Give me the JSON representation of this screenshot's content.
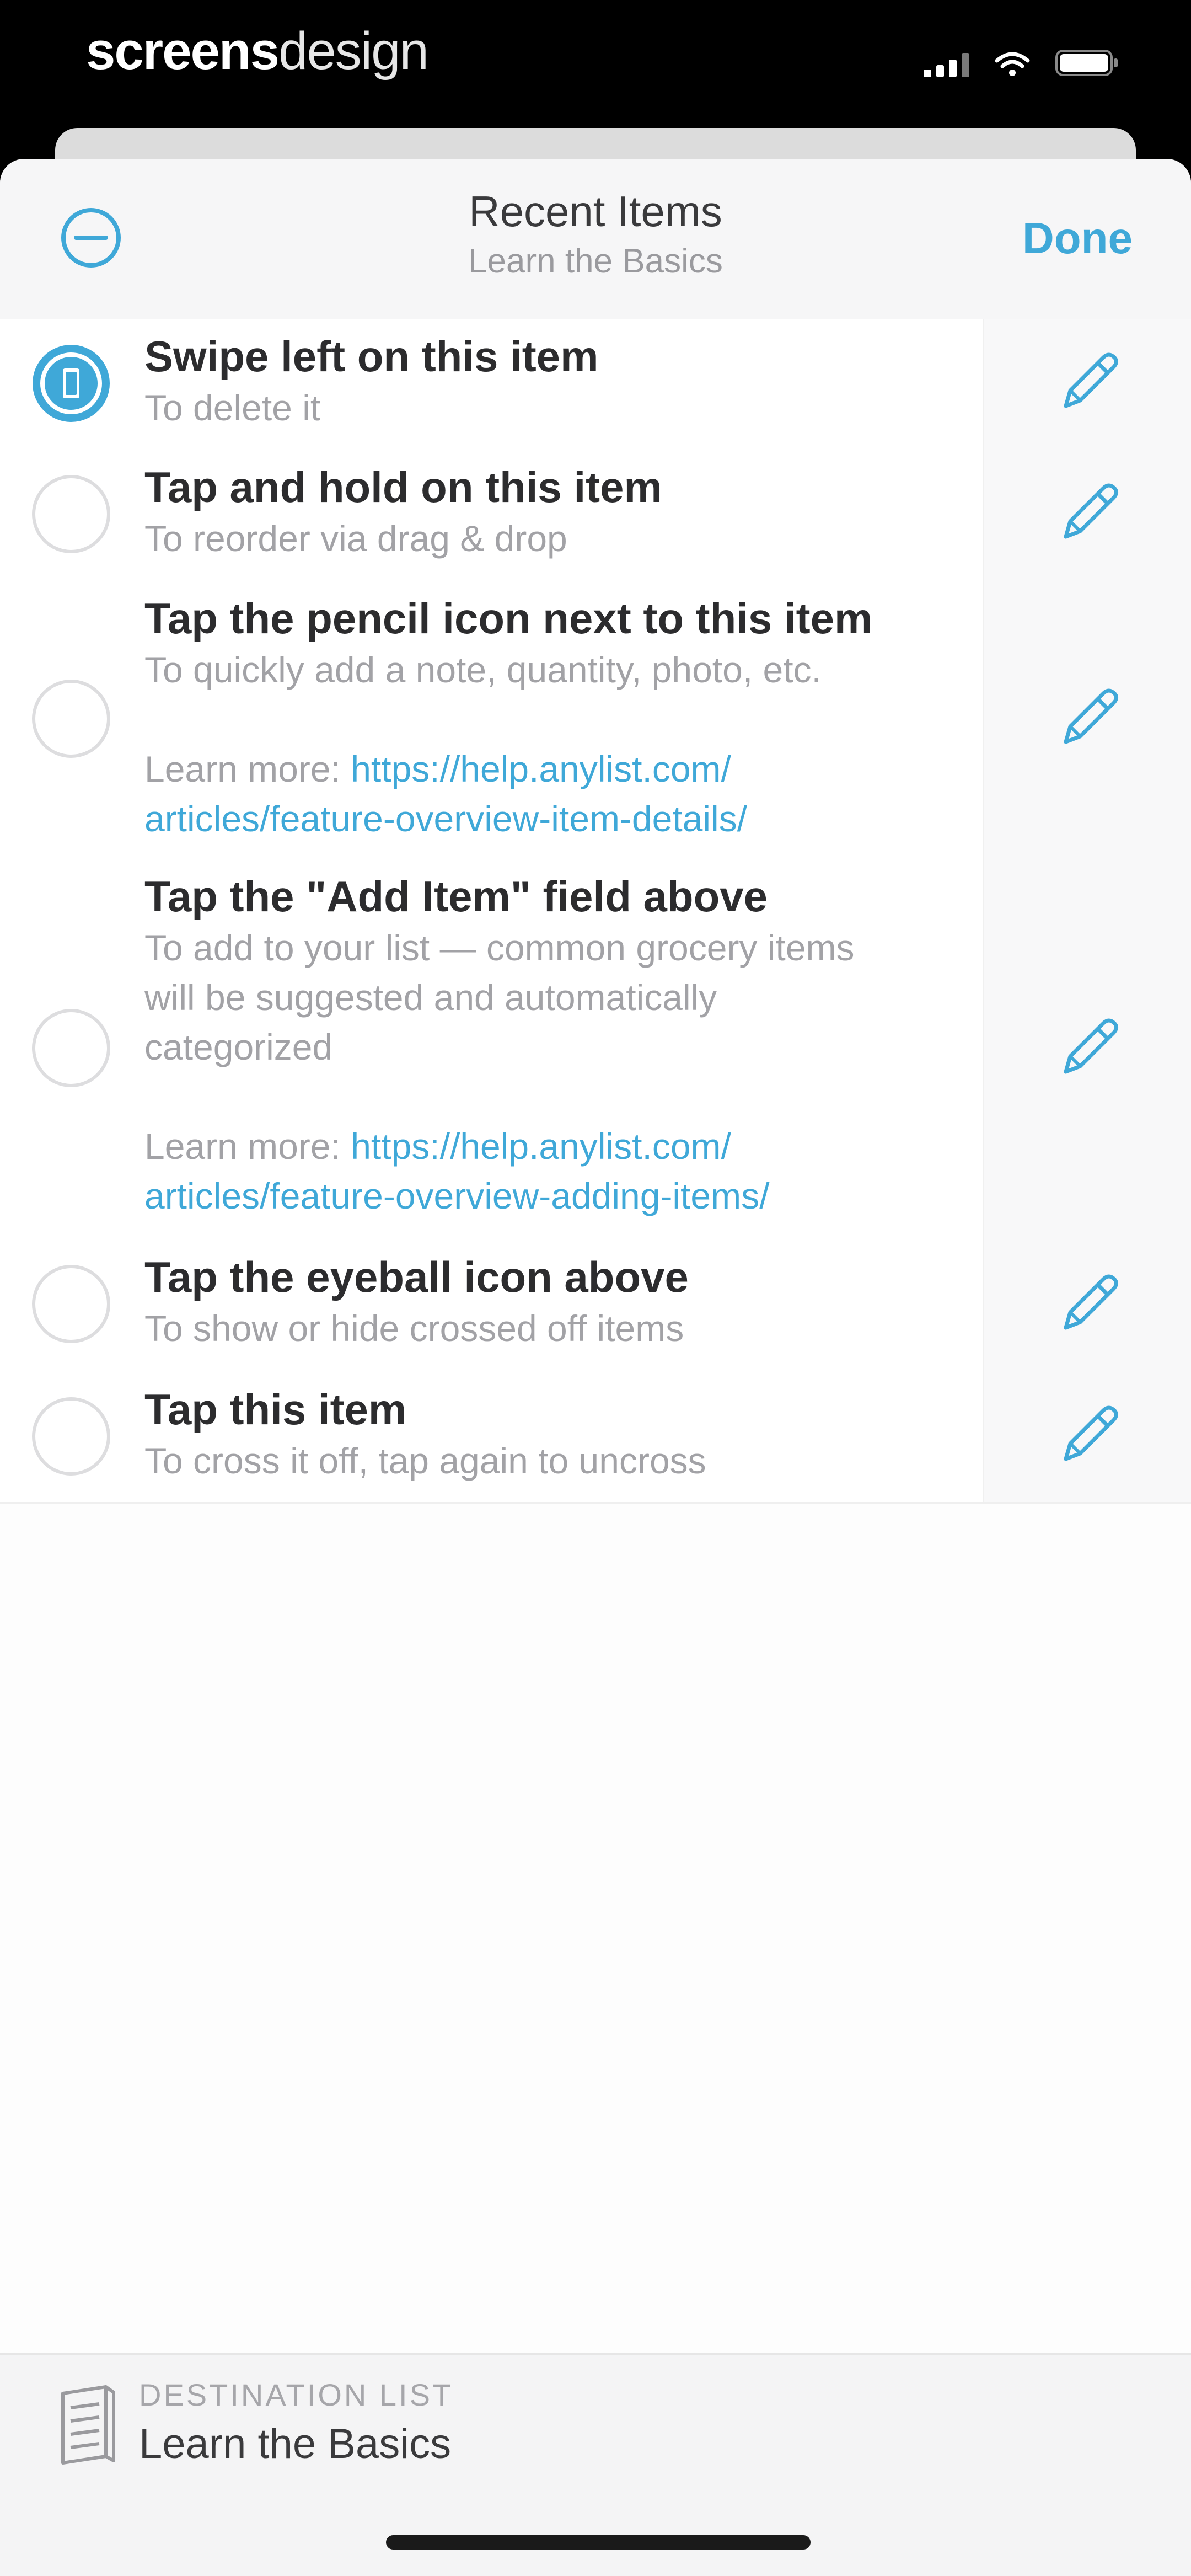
{
  "status_bar": {
    "brand_bold": "screens",
    "brand_light": "design"
  },
  "nav": {
    "title": "Recent Items",
    "subtitle": "Learn the Basics",
    "done_label": "Done"
  },
  "colors": {
    "accent": "#3fa8d8",
    "title_text": "#2c2c2e",
    "secondary_text": "#a2a2a6"
  },
  "items": [
    {
      "title": "Swipe left on this item",
      "note": "To delete it",
      "selected": true
    },
    {
      "title": "Tap and hold on this item",
      "note": "To reorder via drag & drop",
      "selected": false
    },
    {
      "title": "Tap the pencil icon next to this item",
      "note": "To quickly add a note, quantity, photo, etc.",
      "learn_more": "Learn more: ",
      "link_line1": "https://help.anylist.com/",
      "link_line2": "articles/feature-overview-item-details/",
      "selected": false
    },
    {
      "title": "Tap the \"Add Item\" field above",
      "note_line1": "To add to your list — common grocery items",
      "note_line2": "will be suggested and automatically",
      "note_line3": "categorized",
      "learn_more": "Learn more: ",
      "link_line1": "https://help.anylist.com/",
      "link_line2": "articles/feature-overview-adding-items/",
      "selected": false
    },
    {
      "title": "Tap the eyeball icon above",
      "note": "To show or hide crossed off items",
      "selected": false
    },
    {
      "title": "Tap this item",
      "note": "To cross it off, tap again to uncross",
      "selected": false
    }
  ],
  "footer": {
    "label": "DESTINATION LIST",
    "value": "Learn the Basics"
  }
}
